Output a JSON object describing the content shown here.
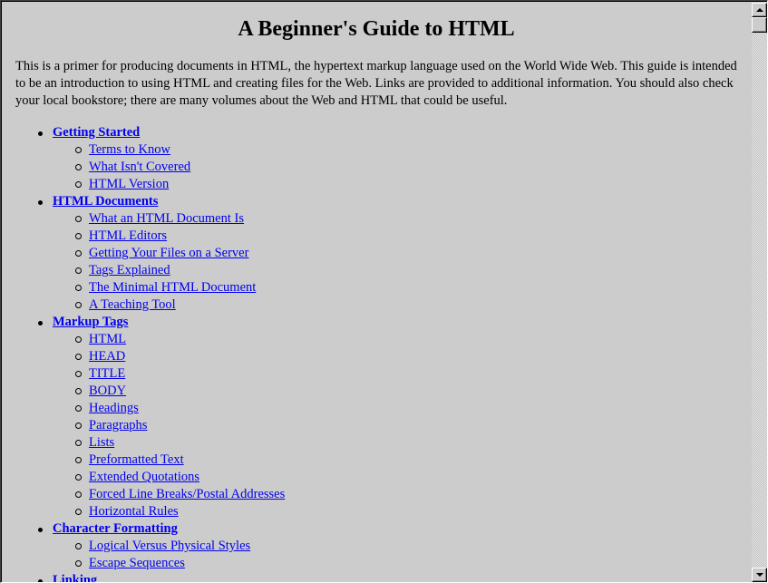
{
  "page": {
    "title": "A Beginner's Guide to HTML",
    "intro": "This is a primer for producing documents in HTML, the hypertext markup language used on the World Wide Web. This guide is intended to be an introduction to using HTML and creating files for the Web. Links are provided to additional information. You should also check your local bookstore; there are many volumes about the Web and HTML that could be useful."
  },
  "toc": [
    {
      "label": "Getting Started",
      "items": [
        "Terms to Know",
        "What Isn't Covered",
        "HTML Version"
      ]
    },
    {
      "label": "HTML Documents",
      "items": [
        "What an HTML Document Is",
        "HTML Editors",
        "Getting Your Files on a Server",
        "Tags Explained",
        "The Minimal HTML Document",
        "A Teaching Tool"
      ]
    },
    {
      "label": "Markup Tags",
      "items": [
        "HTML",
        "HEAD",
        "TITLE",
        "BODY",
        "Headings",
        "Paragraphs",
        "Lists",
        "Preformatted Text",
        "Extended Quotations",
        "Forced Line Breaks/Postal Addresses",
        "Horizontal Rules"
      ]
    },
    {
      "label": "Character Formatting",
      "items": [
        "Logical Versus Physical Styles",
        "Escape Sequences"
      ]
    },
    {
      "label": "Linking",
      "items": []
    }
  ],
  "colors": {
    "background": "#cccccc",
    "link": "#0000ee",
    "text": "#000000"
  },
  "scrollbar": {
    "up_icon": "triangle-up",
    "down_icon": "triangle-down",
    "position_fraction": 0.0
  }
}
